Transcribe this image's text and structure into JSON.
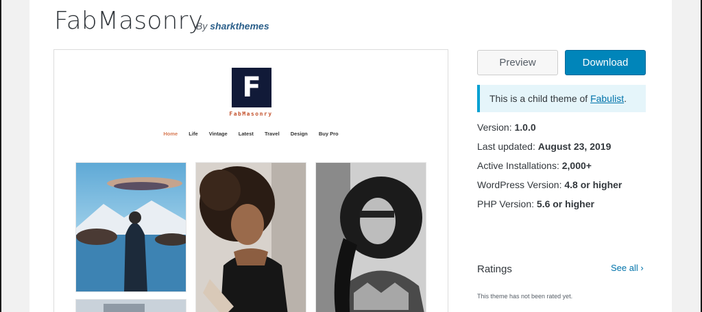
{
  "theme": {
    "title": "FabMasonry",
    "by_prefix": "By",
    "author": "sharkthemes"
  },
  "preview": {
    "logo_letter": "F",
    "site_name": "FabMasonry",
    "menu": [
      "Home",
      "Life",
      "Vintage",
      "Latest",
      "Travel",
      "Design",
      "Buy Pro"
    ]
  },
  "actions": {
    "preview_label": "Preview",
    "download_label": "Download"
  },
  "notice": {
    "text_prefix": "This is a child theme of ",
    "parent_link": "Fabulist",
    "text_suffix": "."
  },
  "meta": {
    "version_label": "Version:",
    "version_value": "1.0.0",
    "updated_label": "Last updated:",
    "updated_value": "August 23, 2019",
    "installs_label": "Active Installations:",
    "installs_value": "2,000+",
    "wp_label": "WordPress Version:",
    "wp_value": "4.8 or higher",
    "php_label": "PHP Version:",
    "php_value": "5.6 or higher"
  },
  "ratings": {
    "title": "Ratings",
    "see_all": "See all",
    "empty_text": "This theme has not been rated yet."
  },
  "colors": {
    "download_bg": "#0085ba",
    "notice_border": "#00a0d2",
    "link": "#0073aa",
    "logo_bg": "#111a38",
    "site_name": "#c4532e"
  }
}
